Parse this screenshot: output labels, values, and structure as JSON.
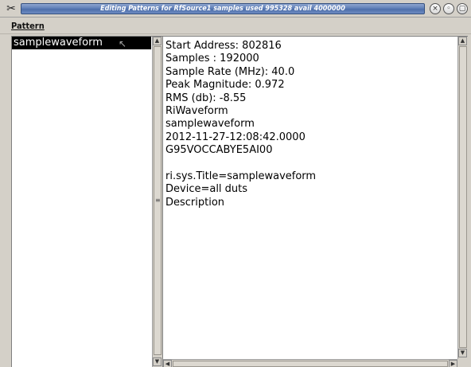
{
  "window": {
    "title": "Editing Patterns for RfSource1 samples used 995328 avail 4000000",
    "app_icon": "tools-icon",
    "buttons": {
      "close": "×",
      "minimize": "◦",
      "maximize": "▢"
    }
  },
  "menubar": {
    "items": [
      {
        "label": "Pattern",
        "mnemonic": "P"
      }
    ]
  },
  "patterns_list": {
    "items": [
      {
        "label": "samplewaveform",
        "selected": true
      }
    ]
  },
  "pattern_info": {
    "lines": [
      "Start Address: 802816",
      "Samples : 192000",
      "Sample Rate (MHz): 40.0",
      "Peak Magnitude: 0.972",
      "RMS (db): -8.55",
      "RiWaveform",
      "samplewaveform",
      "2012-11-27-12:08:42.0000",
      "G95VOCCABYE5AI00",
      "",
      "ri.sys.Title=samplewaveform",
      "Device=all duts",
      "Description"
    ]
  },
  "colors": {
    "title_strip": "#5f7fb8",
    "selection_bg": "#000000",
    "selection_fg": "#ffffff",
    "panel_bg": "#ffffff",
    "chrome_bg": "#d4d0c8"
  }
}
